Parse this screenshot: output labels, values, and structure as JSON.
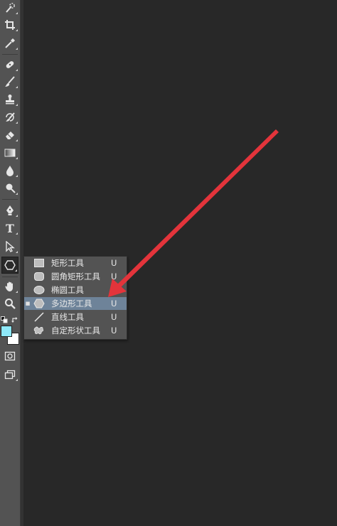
{
  "toolbar": {
    "tools": [
      {
        "name": "quick-selection-tool",
        "icon": "quick-selection-icon"
      },
      {
        "name": "crop-tool",
        "icon": "crop-icon"
      },
      {
        "name": "eyedropper-tool",
        "icon": "eyedropper-icon"
      },
      {
        "name": "spot-healing-tool",
        "icon": "bandage-icon"
      },
      {
        "name": "brush-tool",
        "icon": "brush-icon"
      },
      {
        "name": "clone-stamp-tool",
        "icon": "stamp-icon"
      },
      {
        "name": "history-brush-tool",
        "icon": "history-brush-icon"
      },
      {
        "name": "eraser-tool",
        "icon": "eraser-icon"
      },
      {
        "name": "gradient-tool",
        "icon": "gradient-icon"
      },
      {
        "name": "blur-tool",
        "icon": "drop-icon"
      },
      {
        "name": "dodge-tool",
        "icon": "dodge-icon"
      },
      {
        "name": "pen-tool",
        "icon": "pen-icon"
      },
      {
        "name": "type-tool",
        "icon": "type-icon"
      },
      {
        "name": "path-selection-tool",
        "icon": "path-selection-icon"
      },
      {
        "name": "shape-tool",
        "icon": "polygon-icon"
      },
      {
        "name": "hand-tool",
        "icon": "hand-icon"
      },
      {
        "name": "zoom-tool",
        "icon": "zoom-icon"
      }
    ],
    "type_glyph": "T",
    "foreground_color": "#8ee8f8",
    "background_color": "#ffffff"
  },
  "flyout": {
    "items": [
      {
        "label": "矩形工具",
        "shortcut": "U",
        "icon": "rectangle-icon",
        "selected": false
      },
      {
        "label": "圆角矩形工具",
        "shortcut": "U",
        "icon": "rounded-rectangle-icon",
        "selected": false
      },
      {
        "label": "椭圆工具",
        "shortcut": "U",
        "icon": "ellipse-icon",
        "selected": false
      },
      {
        "label": "多边形工具",
        "shortcut": "U",
        "icon": "polygon-icon",
        "selected": true
      },
      {
        "label": "直线工具",
        "shortcut": "U",
        "icon": "line-icon",
        "selected": false
      },
      {
        "label": "自定形状工具",
        "shortcut": "U",
        "icon": "custom-shape-icon",
        "selected": false
      }
    ],
    "selected_bullet": "■",
    "highlight_color": "#6e8399"
  },
  "annotation": {
    "arrow_color": "#e3343b"
  }
}
